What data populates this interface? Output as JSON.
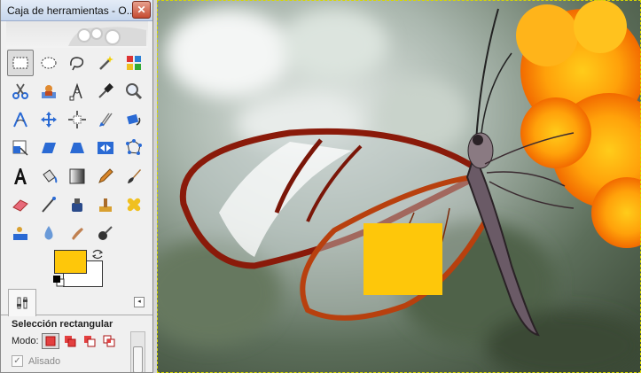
{
  "window": {
    "title": "Caja de herramientas - O...",
    "close_glyph": "✕"
  },
  "tools": [
    {
      "name": "rect-select-icon",
      "active": true
    },
    {
      "name": "ellipse-select-icon"
    },
    {
      "name": "free-select-icon"
    },
    {
      "name": "fuzzy-select-icon"
    },
    {
      "name": "select-by-color-icon"
    },
    {
      "name": "scissors-select-icon"
    },
    {
      "name": "foreground-select-icon"
    },
    {
      "name": "paths-icon"
    },
    {
      "name": "color-picker-icon"
    },
    {
      "name": "zoom-icon"
    },
    {
      "name": "measure-icon"
    },
    {
      "name": "move-icon"
    },
    {
      "name": "align-icon"
    },
    {
      "name": "crop-icon"
    },
    {
      "name": "rotate-icon"
    },
    {
      "name": "scale-icon"
    },
    {
      "name": "shear-icon"
    },
    {
      "name": "perspective-icon"
    },
    {
      "name": "flip-icon"
    },
    {
      "name": "cage-transform-icon"
    },
    {
      "name": "text-icon"
    },
    {
      "name": "bucket-fill-icon"
    },
    {
      "name": "blend-icon"
    },
    {
      "name": "pencil-icon"
    },
    {
      "name": "paintbrush-icon"
    },
    {
      "name": "eraser-icon"
    },
    {
      "name": "airbrush-icon"
    },
    {
      "name": "ink-icon"
    },
    {
      "name": "clone-icon"
    },
    {
      "name": "heal-icon"
    },
    {
      "name": "perspective-clone-icon"
    },
    {
      "name": "smudge-icon"
    },
    {
      "name": "dodge-burn-icon"
    },
    {
      "name": "smudge-tool-icon"
    },
    {
      "name": "blur-sharpen-icon"
    }
  ],
  "colors": {
    "foreground": "#fec70a",
    "background": "#ffffff",
    "swap_glyph": "⇆"
  },
  "tool_options": {
    "tab_icon": "tool-options-icon",
    "tab_menu_glyph": "◂",
    "title": "Selección rectangular",
    "mode_label": "Modo:",
    "modes": [
      "replace-mode-icon",
      "add-mode-icon",
      "subtract-mode-icon",
      "intersect-mode-icon"
    ],
    "antialias_label": "Alisado",
    "antialias_checked": true,
    "check_glyph": "✓"
  },
  "canvas": {
    "image": "glasswing-butterfly-on-orange-flowers",
    "fill_color": "#fec70a"
  }
}
